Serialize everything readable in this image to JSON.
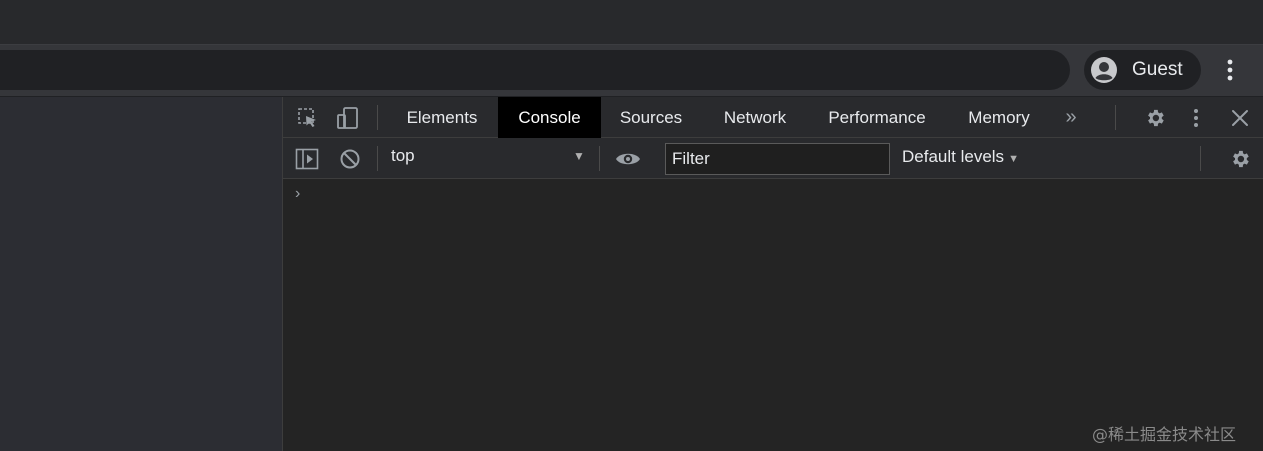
{
  "browser": {
    "profile_label": "Guest"
  },
  "devtools": {
    "tabs": [
      {
        "label": "Elements",
        "active": false
      },
      {
        "label": "Console",
        "active": true
      },
      {
        "label": "Sources",
        "active": false
      },
      {
        "label": "Network",
        "active": false
      },
      {
        "label": "Performance",
        "active": false
      },
      {
        "label": "Memory",
        "active": false
      }
    ],
    "overflow_label": "»",
    "console": {
      "context": "top",
      "filter_placeholder": "Filter",
      "levels_label": "Default levels",
      "prompt": "›"
    }
  },
  "watermark": "@稀土掘金技术社区",
  "colors": {
    "active_tab_bg": "#000000",
    "devtools_bg": "#242424",
    "toolbar_bg": "#35363a"
  },
  "icons": {
    "inspect": "inspect-element-icon",
    "device": "device-toolbar-icon",
    "settings": "gear-icon",
    "kebab": "vertical-dots-icon",
    "close": "close-icon",
    "sidebar": "sidebar-toggle-icon",
    "clear": "clear-console-icon",
    "eye": "eye-icon",
    "avatar": "guest-avatar-icon"
  }
}
